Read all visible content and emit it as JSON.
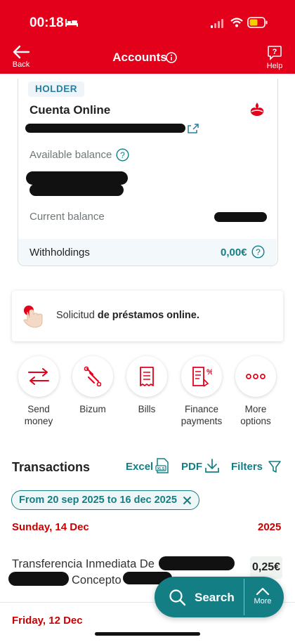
{
  "status_bar": {
    "time": "00:18"
  },
  "header": {
    "title": "Accounts",
    "back_label": "Back",
    "help_label": "Help"
  },
  "account": {
    "holder_badge": "HOLDER",
    "name": "Cuenta Online",
    "available_label": "Available balance",
    "current_label": "Current balance",
    "withholdings_label": "Withholdings",
    "withholdings_value": "0,00€"
  },
  "promo": {
    "text_prefix": "Solicitud ",
    "text_bold": "de préstamos online."
  },
  "quick_actions": [
    {
      "label": "Send money",
      "icon": "transfer-arrows-icon"
    },
    {
      "label": "Bizum",
      "icon": "bizum-icon"
    },
    {
      "label": "Bills",
      "icon": "receipt-icon"
    },
    {
      "label": "Finance payments",
      "icon": "finance-document-icon"
    },
    {
      "label": "More options",
      "icon": "more-dots-icon"
    }
  ],
  "transactions": {
    "title": "Transactions",
    "excel_label": "Excel",
    "pdf_label": "PDF",
    "filters_label": "Filters",
    "date_filter": "From 20 sep 2025 to 16 dec 2025",
    "groups": [
      {
        "day": "Sunday, 14 Dec",
        "year": "2025"
      },
      {
        "day": "Friday, 12 Dec"
      }
    ],
    "items": [
      {
        "desc_line1": "Transferencia Inmediata De",
        "desc_line2": "Concepto",
        "amount": "0,25€"
      }
    ]
  },
  "fab": {
    "search_label": "Search",
    "more_label": "More"
  },
  "colors": {
    "brand_red": "#e2001a",
    "accent_teal": "#137e84",
    "date_red": "#cc0000"
  }
}
